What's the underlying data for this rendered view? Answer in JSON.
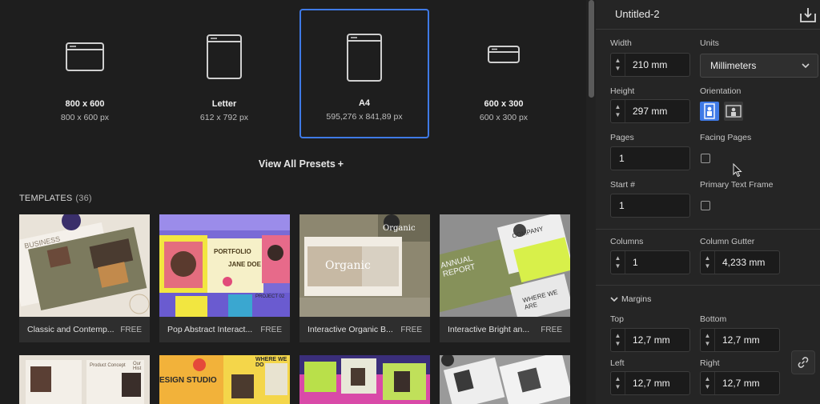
{
  "presets": [
    {
      "name": "800 x 600",
      "size": "800 x 600 px"
    },
    {
      "name": "Letter",
      "size": "612 x 792 px"
    },
    {
      "name": "A4",
      "size": "595,276 x 841,89 px"
    },
    {
      "name": "600 x 300",
      "size": "600 x 300 px"
    }
  ],
  "view_all": "View All Presets",
  "view_all_icon": "+",
  "templates": {
    "title": "TEMPLATES",
    "count": "(36)",
    "cards": [
      {
        "title": "Classic and Contemp...",
        "badge": "FREE"
      },
      {
        "title": "Pop Abstract Interact...",
        "badge": "FREE"
      },
      {
        "title": "Interactive Organic B...",
        "badge": "FREE"
      },
      {
        "title": "Interactive Bright an...",
        "badge": "FREE"
      }
    ],
    "thumb_text": {
      "card1": "BUSINESS",
      "card2_a": "PORTFOLIO",
      "card2_b": "JANE DOE",
      "card2_c": "PROJECT 02",
      "card3_a": "Organic",
      "card3_b": "Organic",
      "card4_a": "ANNUAL REPORT",
      "card4_b": "COMPANY",
      "card4_c": "WHERE WE ARE",
      "row2_a": "Product Concept",
      "row2_b": "Our Hist",
      "row2_c": "ESIGN STUDIO",
      "row2_d": "WHERE WE DO"
    }
  },
  "panel": {
    "title": "Untitled-2",
    "width_label": "Width",
    "width_value": "210 mm",
    "units_label": "Units",
    "units_value": "Millimeters",
    "height_label": "Height",
    "height_value": "297 mm",
    "orientation_label": "Orientation",
    "pages_label": "Pages",
    "pages_value": "1",
    "facing_label": "Facing Pages",
    "start_label": "Start #",
    "start_value": "1",
    "primary_label": "Primary Text Frame",
    "columns_label": "Columns",
    "columns_value": "1",
    "gutter_label": "Column Gutter",
    "gutter_value": "4,233 mm",
    "margins_label": "Margins",
    "top_label": "Top",
    "top_value": "12,7 mm",
    "bottom_label": "Bottom",
    "bottom_value": "12,7 mm",
    "left_label": "Left",
    "left_value": "12,7 mm",
    "right_label": "Right",
    "right_value": "12,7 mm"
  },
  "colors": {
    "accent": "#3f7ae6",
    "background": "#1e1e1e",
    "panel": "#252525"
  }
}
